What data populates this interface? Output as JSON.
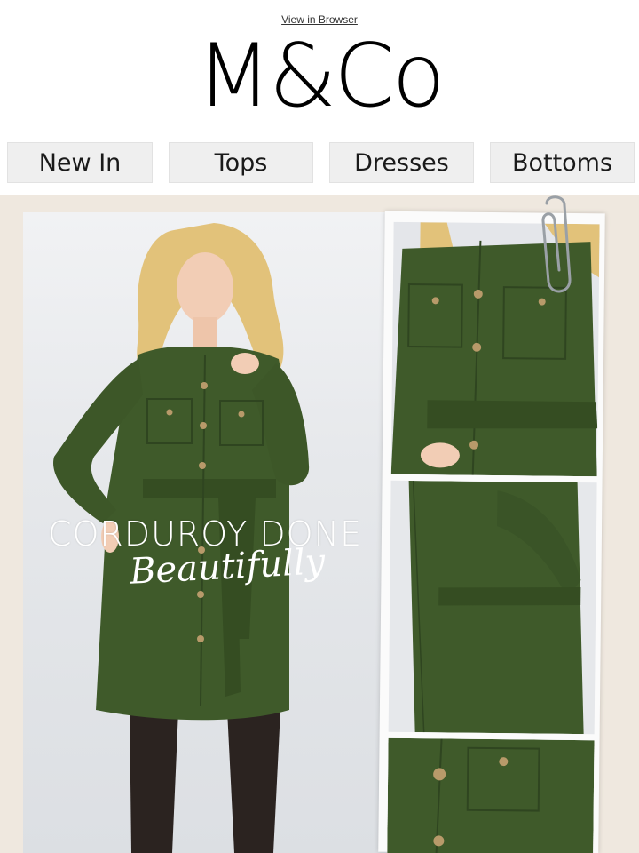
{
  "header": {
    "view_in_browser": "View in Browser",
    "logo_text": "M&Co"
  },
  "nav": {
    "items": [
      "New In",
      "Tops",
      "Dresses",
      "Bottoms"
    ]
  },
  "hero": {
    "headline": "CORDUROY DONE",
    "subline": "Beautifully"
  },
  "colors": {
    "background": "#ffffff",
    "hero_background": "#efe8df",
    "nav_button": "#efefef",
    "dress_green": "#3f5a2a",
    "text": "#1a1a1a"
  }
}
